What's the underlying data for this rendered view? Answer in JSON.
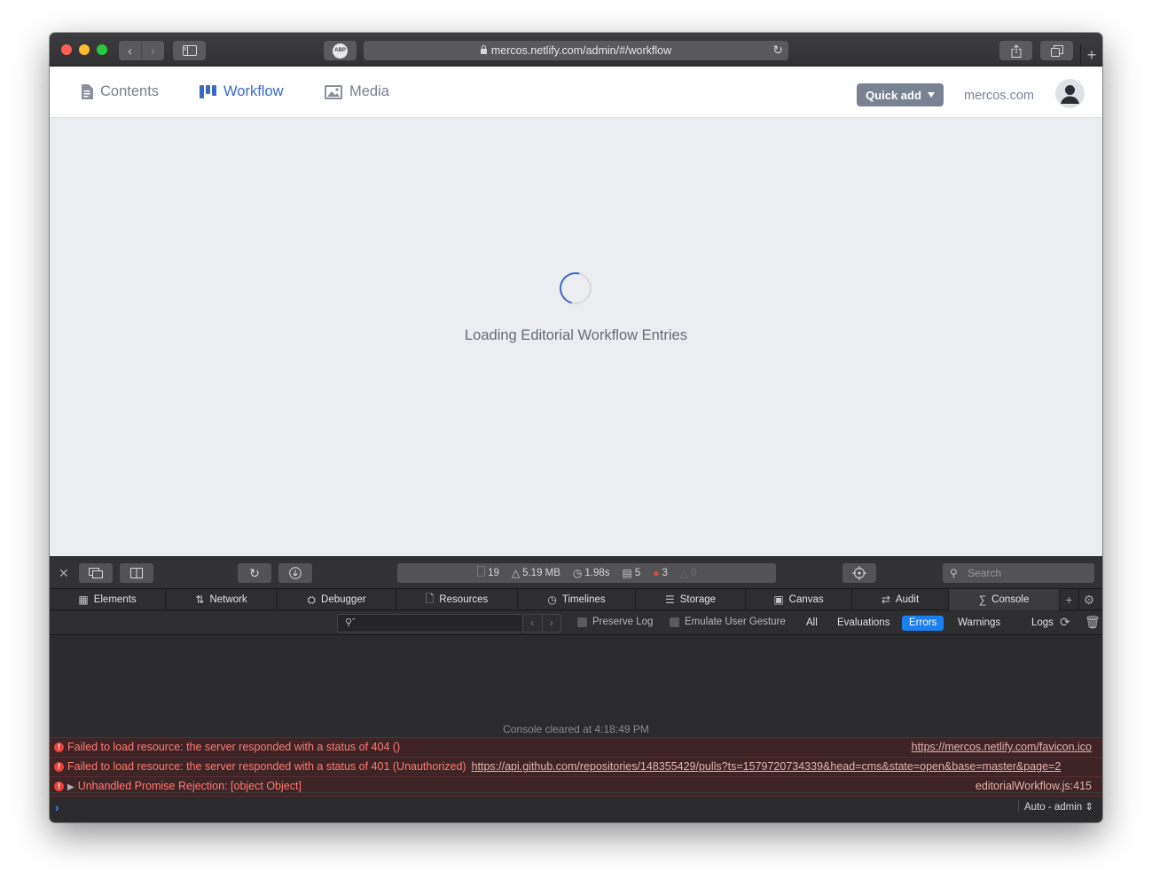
{
  "browser": {
    "url": "mercos.netlify.com/admin/#/workflow",
    "abp_label": "ABP"
  },
  "app": {
    "nav": [
      {
        "label": "Contents"
      },
      {
        "label": "Workflow"
      },
      {
        "label": "Media"
      }
    ],
    "quick_add_label": "Quick add",
    "site_link": "mercos.com",
    "loading_text": "Loading Editorial Workflow Entries",
    "accent_color": "#3a69c7"
  },
  "devtools": {
    "stats": {
      "resources": "19",
      "size": "5.19 MB",
      "time": "1.98s",
      "logs": "5",
      "errors": "3",
      "warnings": "0"
    },
    "search_placeholder": "Search",
    "tabs": [
      {
        "label": "Elements",
        "icon": "elements-icon"
      },
      {
        "label": "Network",
        "icon": "network-icon"
      },
      {
        "label": "Debugger",
        "icon": "debugger-icon"
      },
      {
        "label": "Resources",
        "icon": "resources-icon"
      },
      {
        "label": "Timelines",
        "icon": "timelines-icon"
      },
      {
        "label": "Storage",
        "icon": "storage-icon"
      },
      {
        "label": "Canvas",
        "icon": "canvas-icon"
      },
      {
        "label": "Audit",
        "icon": "audit-icon"
      },
      {
        "label": "Console",
        "icon": "console-icon"
      }
    ],
    "filter": {
      "preserve_log": "Preserve Log",
      "emulate_gesture": "Emulate User Gesture",
      "levels": [
        "All",
        "Evaluations",
        "Errors",
        "Warnings",
        "Logs"
      ],
      "active_level": "Errors"
    },
    "console": {
      "cleared": "Console cleared at 4:18:49 PM",
      "errors": [
        {
          "message": "Failed to load resource: the server responded with a status of 404 ()",
          "link": "",
          "source": "https://mercos.netlify.com/favicon.ico"
        },
        {
          "message": "Failed to load resource: the server responded with a status of 401 (Unauthorized)",
          "link": "https://api.github.com/repositories/148355429/pulls?ts=1579720734339&head=cms&state=open&base=master&page=2",
          "source": ""
        },
        {
          "message": "Unhandled Promise Rejection: [object Object]",
          "link": "",
          "source": "editorialWorkflow.js:415"
        }
      ],
      "context": "Auto - admin"
    },
    "error_color": "#ea4339",
    "active_filter_color": "#1a80f2"
  }
}
